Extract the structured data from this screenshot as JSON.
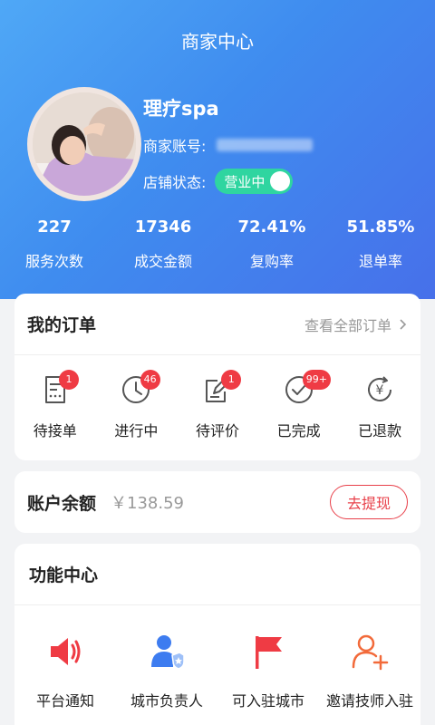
{
  "header": {
    "title": "商家中心"
  },
  "profile": {
    "shop_name": "理疗spa",
    "account_label": "商家账号:",
    "status_label": "店铺状态:",
    "status_value": "营业中"
  },
  "stats": [
    {
      "value": "227",
      "label": "服务次数"
    },
    {
      "value": "17346",
      "label": "成交金额"
    },
    {
      "value": "72.41%",
      "label": "复购率"
    },
    {
      "value": "51.85%",
      "label": "退单率"
    }
  ],
  "orders": {
    "title": "我的订单",
    "view_all": "查看全部订单",
    "items": [
      {
        "label": "待接单",
        "badge": "1",
        "icon": "pending-list-icon"
      },
      {
        "label": "进行中",
        "badge": "46",
        "icon": "clock-icon"
      },
      {
        "label": "待评价",
        "badge": "1",
        "icon": "edit-icon"
      },
      {
        "label": "已完成",
        "badge": "99+",
        "icon": "check-circle-icon"
      },
      {
        "label": "已退款",
        "badge": "",
        "icon": "refund-icon"
      }
    ]
  },
  "balance": {
    "title": "账户余额",
    "value": "￥138.59",
    "button": "去提现"
  },
  "functions": {
    "title": "功能中心",
    "items": [
      {
        "label": "平台通知",
        "icon": "speaker-icon"
      },
      {
        "label": "城市负责人",
        "icon": "city-manager-icon"
      },
      {
        "label": "可入驻城市",
        "icon": "flag-icon"
      },
      {
        "label": "邀请技师入驻",
        "icon": "invite-user-icon"
      }
    ]
  },
  "colors": {
    "header_gradient_start": "#4fa8f6",
    "header_gradient_end": "#4770ea",
    "status_green": "#2fd5a0",
    "accent_red": "#e8404a",
    "icon_blue": "#3d7cf0"
  }
}
